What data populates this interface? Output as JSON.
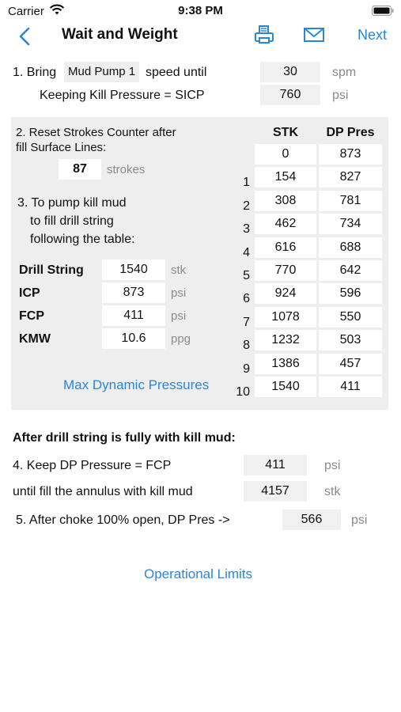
{
  "status_bar": {
    "carrier": "Carrier",
    "time": "9:38 PM"
  },
  "nav": {
    "title": "Wait and Weight",
    "next_label": "Next"
  },
  "step1": {
    "bring_label": "1. Bring",
    "pump": "Mud Pump 1",
    "speed_label": "speed until",
    "speed_value": "30",
    "speed_unit": "spm",
    "keep_label": "Keeping Kill Pressure = SICP",
    "pressure_value": "760",
    "pressure_unit": "psi"
  },
  "step2": {
    "line1": "2. Reset Strokes Counter after",
    "line2": "fill Surface Lines:",
    "strokes_value": "87",
    "strokes_unit": "strokes"
  },
  "step3": {
    "line1": "3. To pump kill mud",
    "line2": "to fill drill string",
    "line3": "following the table:"
  },
  "params": [
    {
      "label": "Drill String",
      "value": "1540",
      "unit": "stk"
    },
    {
      "label": "ICP",
      "value": "873",
      "unit": "psi"
    },
    {
      "label": "FCP",
      "value": "411",
      "unit": "psi"
    },
    {
      "label": "KMW",
      "value": "10.6",
      "unit": "ppg"
    }
  ],
  "max_dynamic_link": "Max Dynamic Pressures",
  "table": {
    "headers": [
      "STK",
      "DP Pres"
    ],
    "rows": [
      {
        "n": "",
        "stk": "0",
        "dp": "873"
      },
      {
        "n": "1",
        "stk": "154",
        "dp": "827"
      },
      {
        "n": "2",
        "stk": "308",
        "dp": "781"
      },
      {
        "n": "3",
        "stk": "462",
        "dp": "734"
      },
      {
        "n": "4",
        "stk": "616",
        "dp": "688"
      },
      {
        "n": "5",
        "stk": "770",
        "dp": "642"
      },
      {
        "n": "6",
        "stk": "924",
        "dp": "596"
      },
      {
        "n": "7",
        "stk": "1078",
        "dp": "550"
      },
      {
        "n": "8",
        "stk": "1232",
        "dp": "503"
      },
      {
        "n": "9",
        "stk": "1386",
        "dp": "457"
      },
      {
        "n": "10",
        "stk": "1540",
        "dp": "411"
      }
    ]
  },
  "after": {
    "heading": "After drill string is fully with kill mud:",
    "step4_label": "4. Keep DP Pressure = FCP",
    "step4_value": "411",
    "step4_unit": "psi",
    "annulus_label": "until fill the annulus with kill mud",
    "annulus_value": "4157",
    "annulus_unit": "stk",
    "step5_label": "5. After choke 100% open, DP Pres ->",
    "step5_value": "566",
    "step5_unit": "psi"
  },
  "operational_limits_link": "Operational Limits",
  "colors": {
    "accent": "#2b86d6",
    "panel": "#eeeeee",
    "field": "#f0f0f0",
    "unit_gray": "#8a8a8a"
  }
}
